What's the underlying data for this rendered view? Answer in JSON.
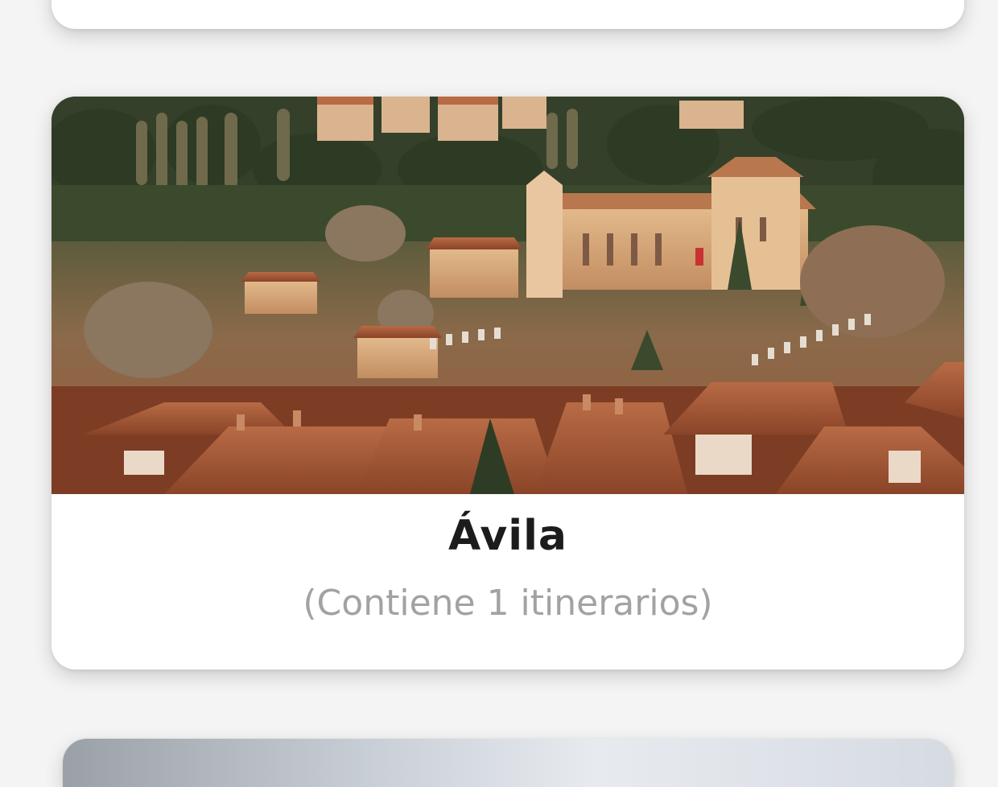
{
  "city_card": {
    "title": "Ávila",
    "subtitle": "(Contiene 1 itinerarios)",
    "image_description": "Aerial view of Ávila with monastery and terracotta rooftops"
  },
  "colors": {
    "page_background": "#f4f4f4",
    "card_background": "#ffffff",
    "title_text": "#1c1c1c",
    "subtitle_text": "#a2a2a2"
  }
}
